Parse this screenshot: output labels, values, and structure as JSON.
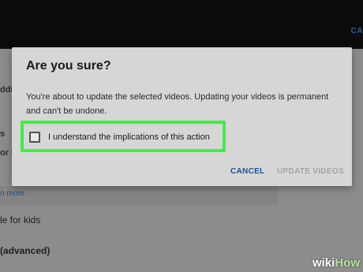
{
  "background": {
    "top_action": "CA",
    "fragments": [
      "ddi",
      "s",
      "or l",
      "n more"
    ],
    "item_kids": "le for kids",
    "item_advanced": "(advanced)"
  },
  "dialog": {
    "title": "Are you sure?",
    "message": "You're about to update the selected videos. Updating your videos is permanent and can't be undone.",
    "checkbox_label": "I understand the implications of this action",
    "checkbox_checked": false,
    "cancel_label": "CANCEL",
    "update_label": "UPDATE VIDEOS"
  },
  "watermark": {
    "prefix": "wiki",
    "suffix": "How"
  },
  "colors": {
    "highlight": "#3cf040",
    "cancel": "#1e4f9c",
    "update_disabled": "#a5a5a5",
    "dialog_bg": "#d6d6d6"
  }
}
